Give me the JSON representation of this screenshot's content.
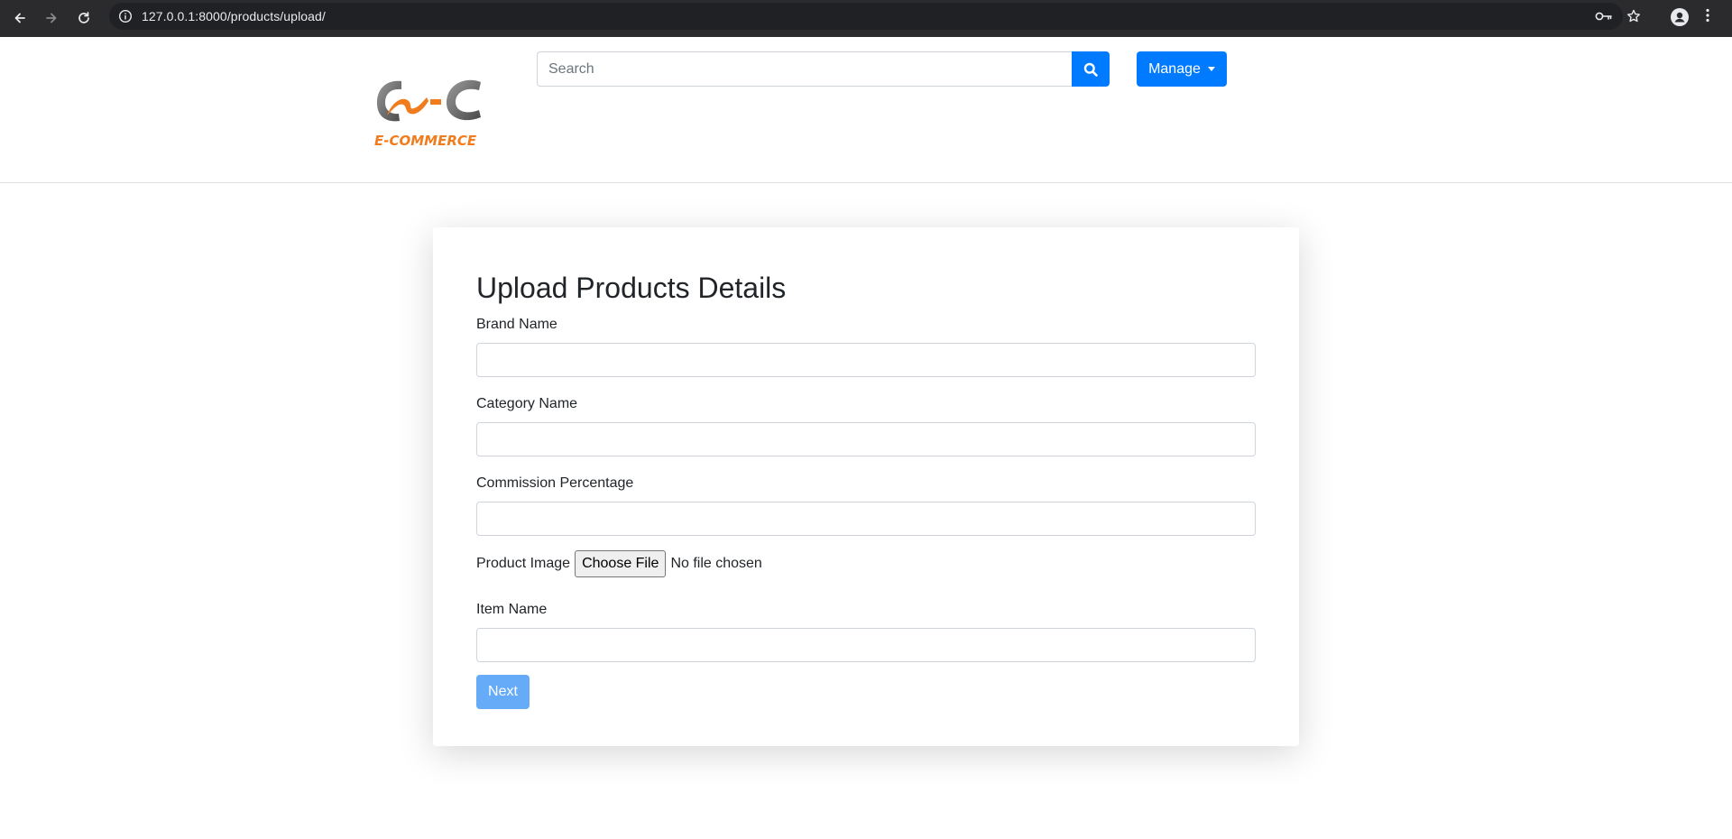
{
  "browser": {
    "url": "127.0.0.1:8000/products/upload/"
  },
  "header": {
    "logo_text": "E-COMMERCE",
    "search_placeholder": "Search",
    "manage_label": "Manage",
    "accent_color": "#007bff"
  },
  "form": {
    "title": "Upload Products Details",
    "fields": [
      {
        "label": "Brand Name",
        "value": ""
      },
      {
        "label": "Category Name",
        "value": ""
      },
      {
        "label": "Commission Percentage",
        "value": ""
      },
      {
        "label": "Item Name",
        "value": ""
      }
    ],
    "file": {
      "label": "Product Image",
      "button_label": "Choose File",
      "status": "No file chosen"
    },
    "submit_label": "Next"
  }
}
